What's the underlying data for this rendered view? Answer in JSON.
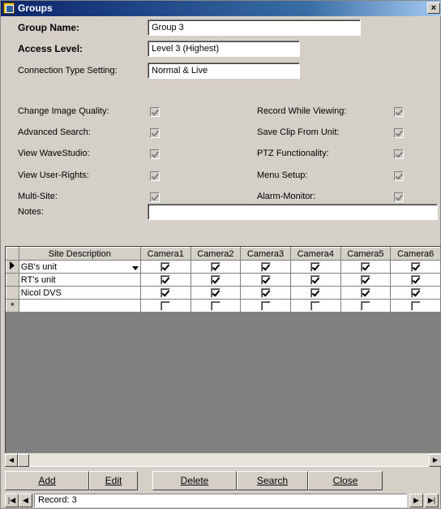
{
  "window": {
    "title": "Groups",
    "close_glyph": "×"
  },
  "form": {
    "group_name_label": "Group Name:",
    "group_name_value": "Group 3",
    "access_level_label": "Access Level:",
    "access_level_value": "Level 3 (Highest)",
    "connection_label": "Connection Type Setting:",
    "connection_value": "Normal & Live",
    "permissions_left": [
      {
        "label": "Change Image Quality:",
        "checked": true
      },
      {
        "label": "Advanced Search:",
        "checked": true
      },
      {
        "label": "View WaveStudio:",
        "checked": true
      },
      {
        "label": "View User-Rights:",
        "checked": true
      },
      {
        "label": "Multi-Site:",
        "checked": true
      }
    ],
    "permissions_right": [
      {
        "label": "Record While Viewing:",
        "checked": true
      },
      {
        "label": "Save Clip From Unit:",
        "checked": true
      },
      {
        "label": "PTZ Functionality:",
        "checked": true
      },
      {
        "label": "Menu Setup:",
        "checked": true
      },
      {
        "label": "Alarm-Monitor:",
        "checked": true
      }
    ],
    "notes_label": "Notes:",
    "notes_value": ""
  },
  "grid": {
    "columns": [
      "Site Description",
      "Camera1",
      "Camera2",
      "Camera3",
      "Camera4",
      "Camera5",
      "Camera6"
    ],
    "rows": [
      {
        "site": "GB's unit",
        "cams": [
          true,
          true,
          true,
          true,
          true,
          true
        ],
        "current": true
      },
      {
        "site": "RT's unit",
        "cams": [
          true,
          true,
          true,
          true,
          true,
          true
        ],
        "current": false
      },
      {
        "site": "Nicol DVS",
        "cams": [
          true,
          true,
          true,
          true,
          true,
          true
        ],
        "current": false
      }
    ],
    "new_row_glyph": "*"
  },
  "buttons": {
    "add": "Add",
    "edit": "Edit",
    "delete": "Delete",
    "search": "Search",
    "close": "Close"
  },
  "navigation": {
    "record": "Record: 3"
  }
}
